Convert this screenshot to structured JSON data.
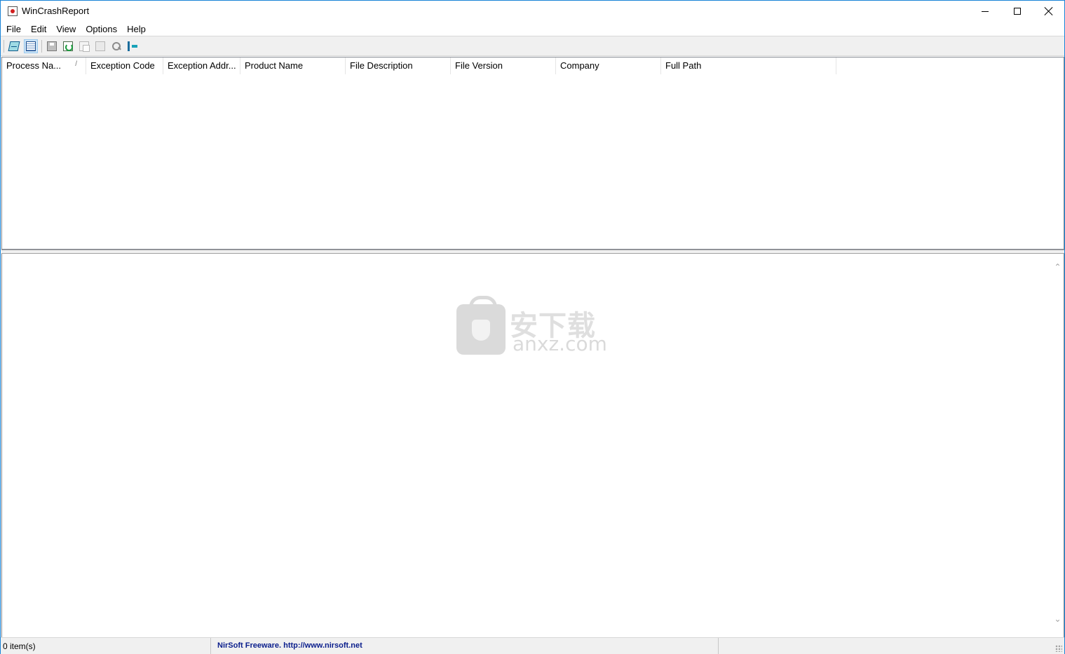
{
  "window": {
    "title": "WinCrashReport"
  },
  "menu": {
    "items": [
      "File",
      "Edit",
      "View",
      "Options",
      "Help"
    ]
  },
  "toolbar": {
    "buttons": [
      "options-icon",
      "table-view-icon",
      "save-icon",
      "refresh-icon",
      "copy-icon",
      "properties-icon",
      "find-icon",
      "exit-icon"
    ]
  },
  "list": {
    "columns": [
      "Process Na...",
      "Exception Code",
      "Exception Addr...",
      "Product Name",
      "File Description",
      "File Version",
      "Company",
      "Full Path"
    ],
    "sort_indicator": "/",
    "rows": []
  },
  "watermark": {
    "cn_text": "安下载",
    "en_text": "anxz.com"
  },
  "status": {
    "count": "0 item(s)",
    "credit": "NirSoft Freeware.  http://www.nirsoft.net"
  },
  "colors": {
    "window_border": "#1883d7",
    "link_text": "#0a1e8c",
    "toolbar_bg": "#f0f0f0"
  }
}
